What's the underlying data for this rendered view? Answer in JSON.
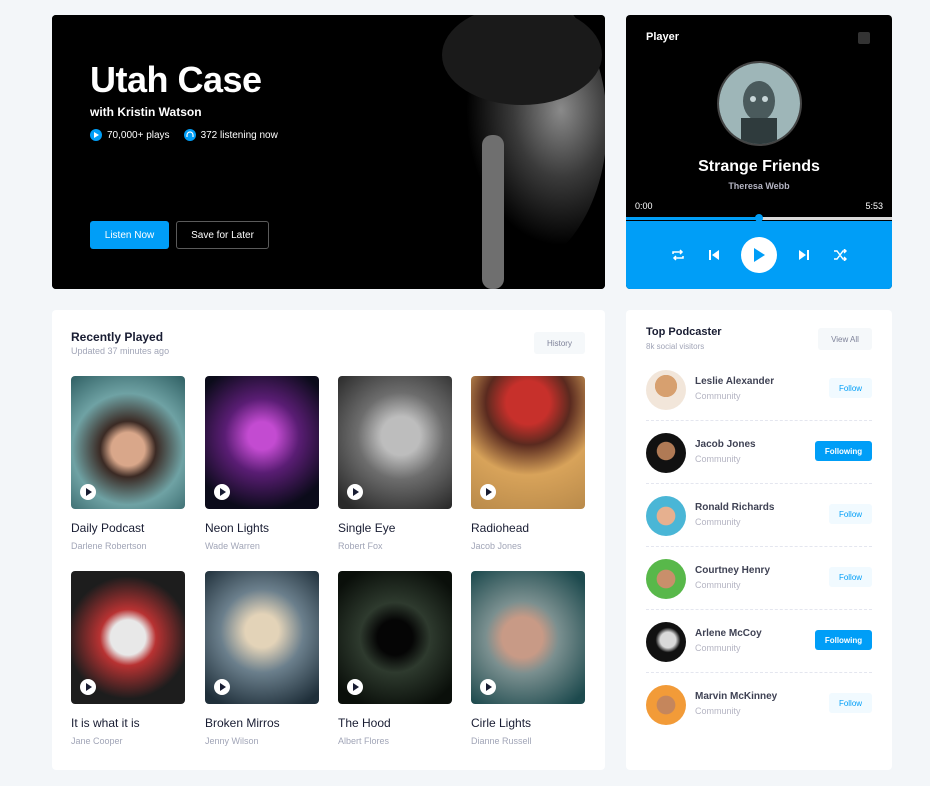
{
  "hero": {
    "title": "Utah Case",
    "subtitle": "with Kristin Watson",
    "plays": "70,000+ plays",
    "listening": "372 listening now",
    "listen_btn": "Listen Now",
    "save_btn": "Save for Later"
  },
  "player": {
    "title": "Player",
    "song": "Strange Friends",
    "artist": "Theresa Webb",
    "time_start": "0:00",
    "time_end": "5:53",
    "progress": 0.5
  },
  "recent": {
    "title": "Recently Played",
    "updated": "Updated 37 minutes ago",
    "history_btn": "History",
    "cards": [
      {
        "title": "Daily Podcast",
        "artist": "Darlene Robertson"
      },
      {
        "title": "Neon Lights",
        "artist": "Wade Warren"
      },
      {
        "title": "Single Eye",
        "artist": "Robert Fox"
      },
      {
        "title": "Radiohead",
        "artist": "Jacob Jones"
      },
      {
        "title": "It is what it is",
        "artist": "Jane Cooper"
      },
      {
        "title": "Broken Mirros",
        "artist": "Jenny Wilson"
      },
      {
        "title": "The Hood",
        "artist": "Albert Flores"
      },
      {
        "title": "Cirle Lights",
        "artist": "Dianne Russell"
      }
    ]
  },
  "podcasters": {
    "title": "Top Podcaster",
    "subtitle": "8k social visitors",
    "view_all": "View All",
    "items": [
      {
        "name": "Leslie Alexander",
        "role": "Community",
        "action": "Follow"
      },
      {
        "name": "Jacob Jones",
        "role": "Community",
        "action": "Following"
      },
      {
        "name": "Ronald Richards",
        "role": "Community",
        "action": "Follow"
      },
      {
        "name": "Courtney Henry",
        "role": "Community",
        "action": "Follow"
      },
      {
        "name": "Arlene McCoy",
        "role": "Community",
        "action": "Following"
      },
      {
        "name": "Marvin McKinney",
        "role": "Community",
        "action": "Follow"
      }
    ]
  }
}
